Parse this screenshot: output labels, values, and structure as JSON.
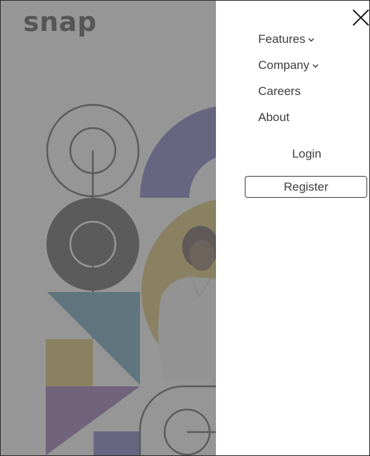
{
  "brand": {
    "logo_text": "snap"
  },
  "nav": {
    "items": [
      {
        "label": "Features",
        "has_dropdown": true,
        "icon": "chevron-down-icon"
      },
      {
        "label": "Company",
        "has_dropdown": true,
        "icon": "chevron-down-icon"
      },
      {
        "label": "Careers",
        "has_dropdown": false
      },
      {
        "label": "About",
        "has_dropdown": false
      }
    ]
  },
  "auth": {
    "login_label": "Login",
    "register_label": "Register"
  },
  "icons": {
    "close": "close-icon"
  },
  "colors": {
    "text": "#3d3d3d",
    "logo": "#1a1a1a",
    "overlay": "rgba(110,110,110,0.72)",
    "art_purple": "#5b51b0",
    "art_yellow": "#d3b54a",
    "art_teal": "#3f8aa8",
    "art_violet": "#7a4aa0",
    "art_dark": "#2b2b2b"
  }
}
